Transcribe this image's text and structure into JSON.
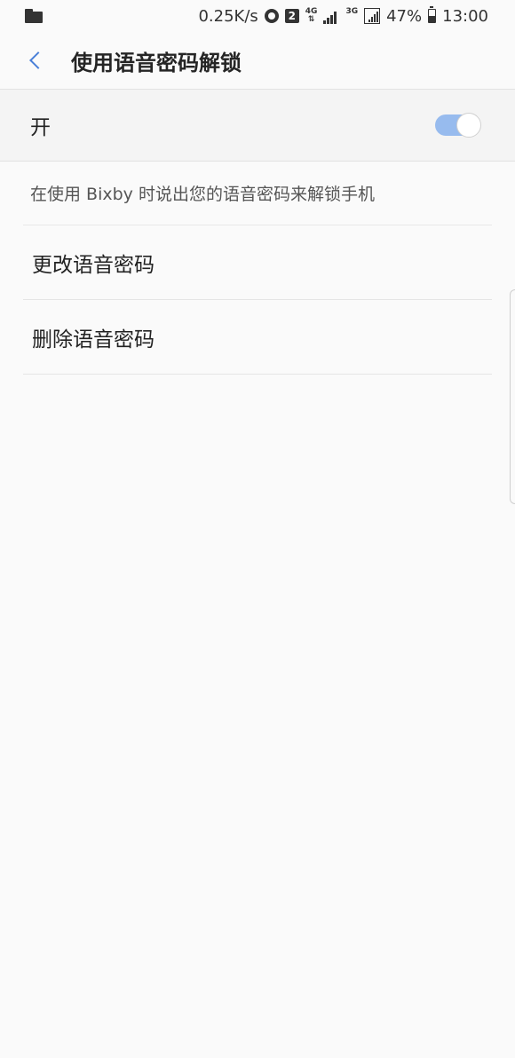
{
  "status_bar": {
    "net_speed": "0.25K/s",
    "sim_slot": "2",
    "net_type_1": "4G",
    "net_type_2": "3G",
    "battery": "47%",
    "time": "13:00"
  },
  "header": {
    "title": "使用语音密码解锁"
  },
  "master_switch": {
    "label": "开",
    "state": "on",
    "accent_color": "#97bbee"
  },
  "content": {
    "description": "在使用 Bixby 时说出您的语音密码来解锁手机",
    "items": [
      {
        "label": "更改语音密码"
      },
      {
        "label": "删除语音密码"
      }
    ]
  }
}
